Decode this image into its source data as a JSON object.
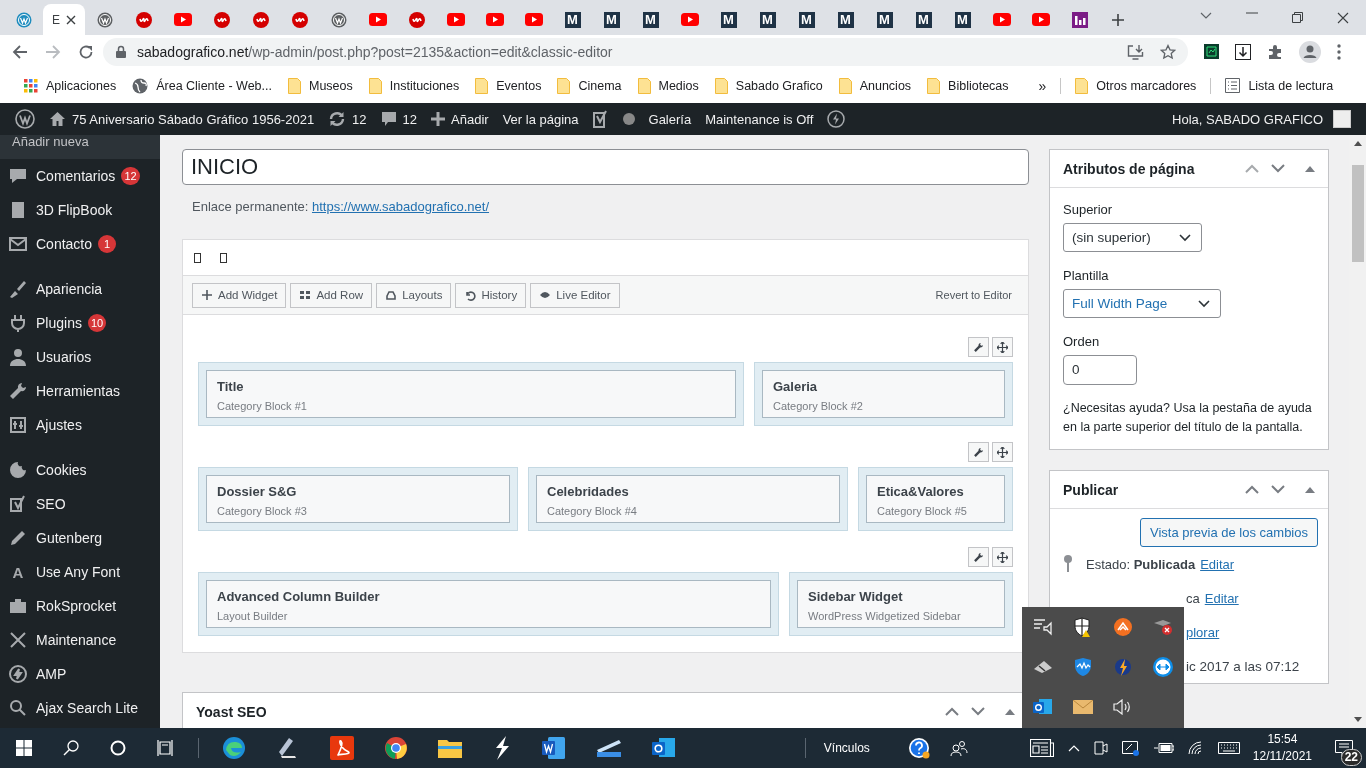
{
  "browser": {
    "tabs": [
      {
        "kind": "wp_blue",
        "selected": false
      },
      {
        "kind": "page",
        "title": "E",
        "selected": true
      },
      {
        "kind": "wp",
        "selected": false
      },
      {
        "kind": "wave",
        "selected": false
      },
      {
        "kind": "play",
        "selected": false
      },
      {
        "kind": "wave",
        "selected": false
      },
      {
        "kind": "wave",
        "selected": false
      },
      {
        "kind": "wave",
        "selected": false
      },
      {
        "kind": "wp",
        "selected": false
      },
      {
        "kind": "play",
        "selected": false
      },
      {
        "kind": "wave",
        "selected": false
      },
      {
        "kind": "play",
        "selected": false
      },
      {
        "kind": "play",
        "selected": false
      },
      {
        "kind": "play",
        "selected": false
      },
      {
        "kind": "letter",
        "icon_text": "M",
        "selected": false
      },
      {
        "kind": "letter",
        "icon_text": "M",
        "selected": false
      },
      {
        "kind": "letter",
        "icon_text": "M",
        "selected": false
      },
      {
        "kind": "play",
        "selected": false
      },
      {
        "kind": "letter",
        "icon_text": "M",
        "selected": false
      },
      {
        "kind": "letter",
        "icon_text": "M",
        "selected": false
      },
      {
        "kind": "letter",
        "icon_text": "M",
        "selected": false
      },
      {
        "kind": "letter",
        "icon_text": "M",
        "selected": false
      },
      {
        "kind": "letter",
        "icon_text": "M",
        "selected": false
      },
      {
        "kind": "letter",
        "icon_text": "M",
        "selected": false
      },
      {
        "kind": "letter",
        "icon_text": "M",
        "selected": false
      },
      {
        "kind": "play",
        "selected": false
      },
      {
        "kind": "play",
        "selected": false
      },
      {
        "kind": "chart",
        "selected": false
      }
    ],
    "address": {
      "host": "sabadografico.net",
      "path": "/wp-admin/post.php?post=2135&action=edit&classic-editor"
    },
    "bookmarks": [
      {
        "kind": "apps",
        "label": "Aplicaciones"
      },
      {
        "kind": "globe",
        "label": "Área Cliente - Web..."
      },
      {
        "kind": "folder",
        "label": "Museos"
      },
      {
        "kind": "folder",
        "label": "Instituciones"
      },
      {
        "kind": "folder",
        "label": "Eventos"
      },
      {
        "kind": "folder",
        "label": "Cinema"
      },
      {
        "kind": "folder",
        "label": "Medios"
      },
      {
        "kind": "folder",
        "label": "Sabado Grafico"
      },
      {
        "kind": "folder",
        "label": "Anuncios"
      },
      {
        "kind": "folder",
        "label": "Bibliotecas"
      }
    ],
    "more": "»",
    "other_bookmarks": "Otros marcadores",
    "reading_list": "Lista de lectura"
  },
  "admin_bar": {
    "site": "75 Aniversario Sábado Gráfico 1956-2021",
    "updates": "12",
    "comments": "12",
    "add": "Añadir",
    "view": "Ver la página",
    "gallery": "Galería",
    "maintenance": "Maintenance is Off",
    "greeting": "Hola, SABADO GRAFICO"
  },
  "sidebar": {
    "submenu_item": "Añadir nueva",
    "groups": [
      [
        {
          "kind": "comments",
          "label": "Comentarios",
          "badge": "12"
        },
        {
          "kind": "book",
          "label": "3D FlipBook"
        },
        {
          "kind": "mail",
          "label": "Contacto",
          "badge": "1"
        }
      ],
      [
        {
          "kind": "brush",
          "label": "Apariencia"
        },
        {
          "kind": "plug",
          "label": "Plugins",
          "badge": "10"
        },
        {
          "kind": "user",
          "label": "Usuarios"
        },
        {
          "kind": "wrench",
          "label": "Herramientas"
        },
        {
          "kind": "sliders",
          "label": "Ajustes"
        }
      ],
      [
        {
          "kind": "cookie",
          "label": "Cookies"
        },
        {
          "kind": "logo",
          "label": "SEO"
        },
        {
          "kind": "pencil",
          "label": "Gutenberg"
        },
        {
          "kind": "font",
          "icon_text": "A",
          "label": "Use Any Font"
        },
        {
          "kind": "briefcase",
          "label": "RokSprocket"
        },
        {
          "kind": "tools",
          "label": "Maintenance"
        },
        {
          "kind": "bolt",
          "label": "AMP"
        },
        {
          "kind": "search",
          "label": "Ajax Search Lite"
        }
      ]
    ]
  },
  "editor": {
    "title": "INICIO",
    "permalink_label": "Enlace permanente:",
    "permalink": "https://www.sabadografico.net/",
    "builder": {
      "tools": [
        {
          "kind": "add",
          "label": "Add Widget"
        },
        {
          "kind": "grid",
          "label": "Add Row"
        },
        {
          "kind": "layouts",
          "label": "Layouts"
        },
        {
          "kind": "history",
          "label": "History"
        },
        {
          "kind": "eye",
          "label": "Live Editor"
        }
      ],
      "revert": "Revert to Editor",
      "rows": [
        [
          {
            "title": "Title",
            "subtitle": "Category Block #1"
          },
          {
            "title": "Galeria",
            "subtitle": "Category Block #2"
          }
        ],
        [
          {
            "title": "Dossier S&G",
            "subtitle": "Category Block #3"
          },
          {
            "title": "Celebridades",
            "subtitle": "Category Block #4"
          },
          {
            "title": "Etica&Valores",
            "subtitle": "Category Block #5"
          }
        ],
        [
          {
            "title": "Advanced Column Builder",
            "subtitle": "Layout Builder"
          },
          {
            "title": "Sidebar Widget",
            "subtitle": "WordPress Widgetized Sidebar"
          }
        ]
      ]
    },
    "yoast_title": "Yoast SEO"
  },
  "page_attributes": {
    "title": "Atributos de página",
    "parent_label": "Superior",
    "parent": "(sin superior)",
    "template_label": "Plantilla",
    "template": "Full Width Page",
    "order_label": "Orden",
    "order": "0",
    "help": "¿Necesitas ayuda? Usa la pestaña de ayuda en la parte superior del título de la pantalla."
  },
  "publish": {
    "title": "Publicar",
    "preview": "Vista previa de los cambios",
    "status_label": "Estado:",
    "status": "Publicada",
    "status_link": "Editar",
    "visibility_tail": "ca",
    "visibility_link": "Editar",
    "revisions_link": "plorar",
    "date_tail": "ic 2017 a las 07:12"
  },
  "taskbar": {
    "toolbar_label": "Vínculos",
    "time": "15:54",
    "date": "12/11/2021",
    "notifications": "22"
  }
}
